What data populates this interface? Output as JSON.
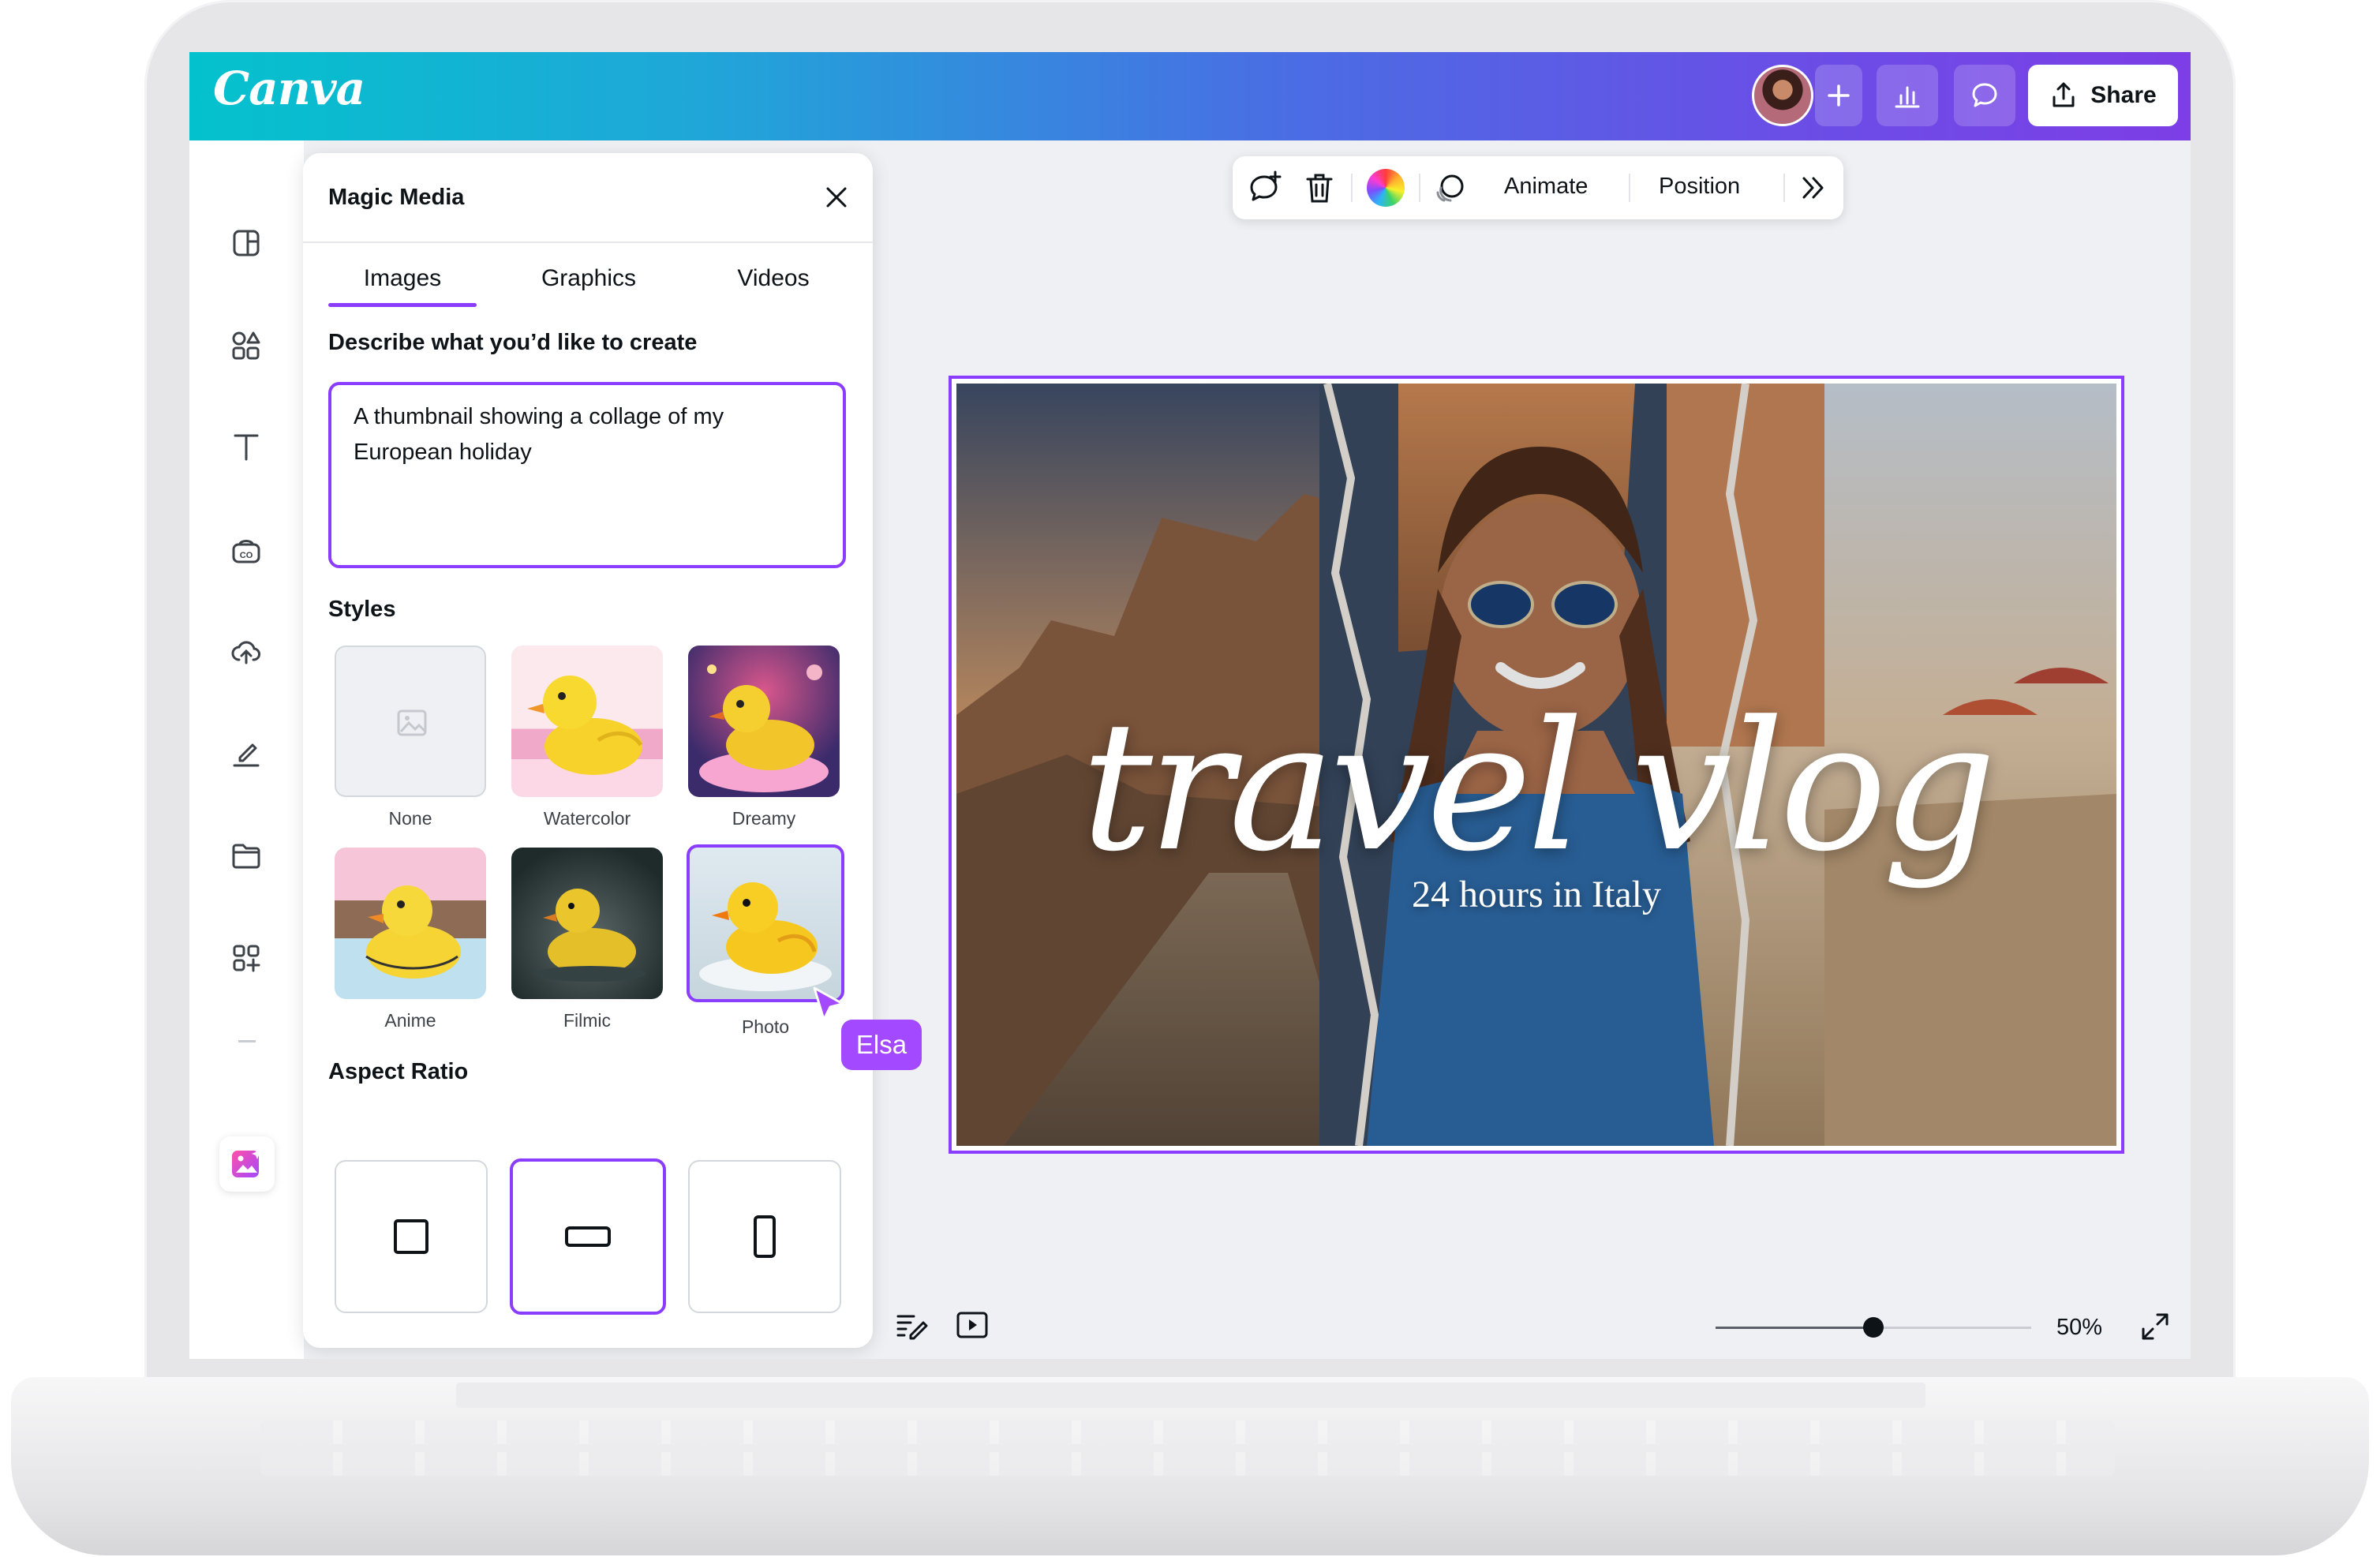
{
  "app": {
    "logo": "Canva"
  },
  "topbar": {
    "share_label": "Share",
    "avatar": {
      "icon": "avatar"
    },
    "icons": [
      "plus-icon",
      "insights-icon",
      "comment-icon",
      "share-upload-icon"
    ],
    "gradient": [
      "#04c2cd",
      "#7d3ee6"
    ]
  },
  "rail": {
    "items": [
      "templates-icon",
      "elements-icon",
      "text-icon",
      "brand-icon",
      "uploads-icon",
      "draw-icon",
      "projects-icon",
      "apps-icon",
      "magic-media-icon"
    ],
    "fab_icon": "magic-sparkle-icon"
  },
  "panel": {
    "title": "Magic Media",
    "tabs": [
      {
        "label": "Images",
        "active": true
      },
      {
        "label": "Graphics",
        "active": false
      },
      {
        "label": "Videos",
        "active": false
      }
    ],
    "describe_label": "Describe what you’d like to create",
    "prompt_value": "A thumbnail showing a collage of my European holiday",
    "styles_label": "Styles",
    "styles": [
      {
        "label": "None",
        "selected": false
      },
      {
        "label": "Watercolor",
        "selected": false
      },
      {
        "label": "Dreamy",
        "selected": false
      },
      {
        "label": "Anime",
        "selected": false
      },
      {
        "label": "Filmic",
        "selected": false
      },
      {
        "label": "Photo",
        "selected": true
      }
    ],
    "aspect_label": "Aspect Ratio",
    "aspect_ratios": [
      {
        "icon": "square-ratio-icon",
        "selected": false
      },
      {
        "icon": "landscape-ratio-icon",
        "selected": true
      },
      {
        "icon": "portrait-ratio-icon",
        "selected": false
      }
    ]
  },
  "cursor": {
    "name": "Elsa",
    "color": "#a349ff"
  },
  "floating_toolbar": {
    "animate_label": "Animate",
    "position_label": "Position",
    "icons": [
      "add-comment-icon",
      "trash-icon",
      "color-icon",
      "animate-icon",
      "more-chevrons-icon"
    ]
  },
  "canvas": {
    "title": "travel vlog",
    "subtitle": "24 hours in Italy",
    "selection_color": "#8b3dff"
  },
  "bottom_bar": {
    "zoom_label": "50%",
    "zoom_fraction": 0.5,
    "icons": [
      "notes-icon",
      "present-icon",
      "fullscreen-icon"
    ]
  },
  "colors": {
    "accent": "#8b3dff",
    "text": "#0e1318"
  }
}
